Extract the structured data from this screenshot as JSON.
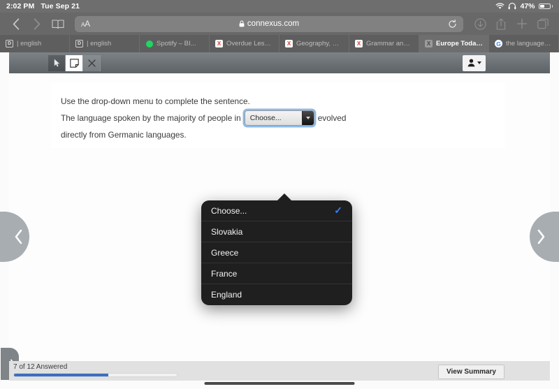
{
  "status_bar": {
    "time": "2:02 PM",
    "date": "Tue Sep 21",
    "battery_percent": "47%",
    "wifi_icon": "wifi-icon",
    "headphones_icon": "headphones-icon",
    "battery_icon": "battery-icon"
  },
  "browser": {
    "back_icon": "chevron-left-icon",
    "forward_icon": "chevron-right-icon",
    "bookmarks_icon": "book-icon",
    "text_size_label": "AA",
    "lock_icon": "lock-icon",
    "url": "connexus.com",
    "reload_icon": "reload-icon",
    "downloads_icon": "download-icon",
    "share_icon": "share-icon",
    "new_tab_icon": "plus-icon",
    "tabs_overview_icon": "tabs-icon"
  },
  "tabs": [
    {
      "label": "| english",
      "favicon": "doc-icon",
      "active": false
    },
    {
      "label": "| english",
      "favicon": "doc-icon",
      "active": false
    },
    {
      "label": "Spotify – BI...",
      "favicon": "spotify-icon",
      "active": false
    },
    {
      "label": "Overdue Lesso...",
      "favicon": "excel-icon",
      "active": false
    },
    {
      "label": "Geography, Gr...",
      "favicon": "excel-icon",
      "active": false
    },
    {
      "label": "Grammar and P...",
      "favicon": "excel-icon",
      "active": false
    },
    {
      "label": "Europe Today P...",
      "favicon": "broken-image-icon",
      "active": true
    },
    {
      "label": "the language s...",
      "favicon": "google-icon",
      "active": false
    }
  ],
  "app_toolbar": {
    "pointer_icon": "cursor-arrow-icon",
    "note_icon": "sticky-note-icon",
    "close_icon": "close-x-icon",
    "user_icon": "user-icon",
    "user_caret_icon": "chevron-down-icon"
  },
  "question": {
    "instruction": "Use the drop-down menu to complete the sentence.",
    "sentence_before": "The language spoken by the majority of people in",
    "sentence_after": "evolved",
    "sentence_line2": "directly from Germanic languages."
  },
  "dropdown": {
    "selected_value": "Choose...",
    "arrow_icon": "triangle-down-icon",
    "open": true,
    "check_icon": "checkmark-icon",
    "options": [
      {
        "label": "Choose...",
        "selected": true
      },
      {
        "label": "Slovakia",
        "selected": false
      },
      {
        "label": "Greece",
        "selected": false
      },
      {
        "label": "France",
        "selected": false
      },
      {
        "label": "England",
        "selected": false
      }
    ]
  },
  "navigation": {
    "previous_icon": "chevron-left-icon",
    "next_icon": "chevron-right-icon",
    "drawer_handle_icon": "chevron-right-icon"
  },
  "footer": {
    "progress_label": "7 of 12 Answered",
    "answered": 7,
    "total": 12,
    "progress_percent": 58,
    "progress_color": "#3b6fbf",
    "view_summary_label": "View Summary"
  }
}
